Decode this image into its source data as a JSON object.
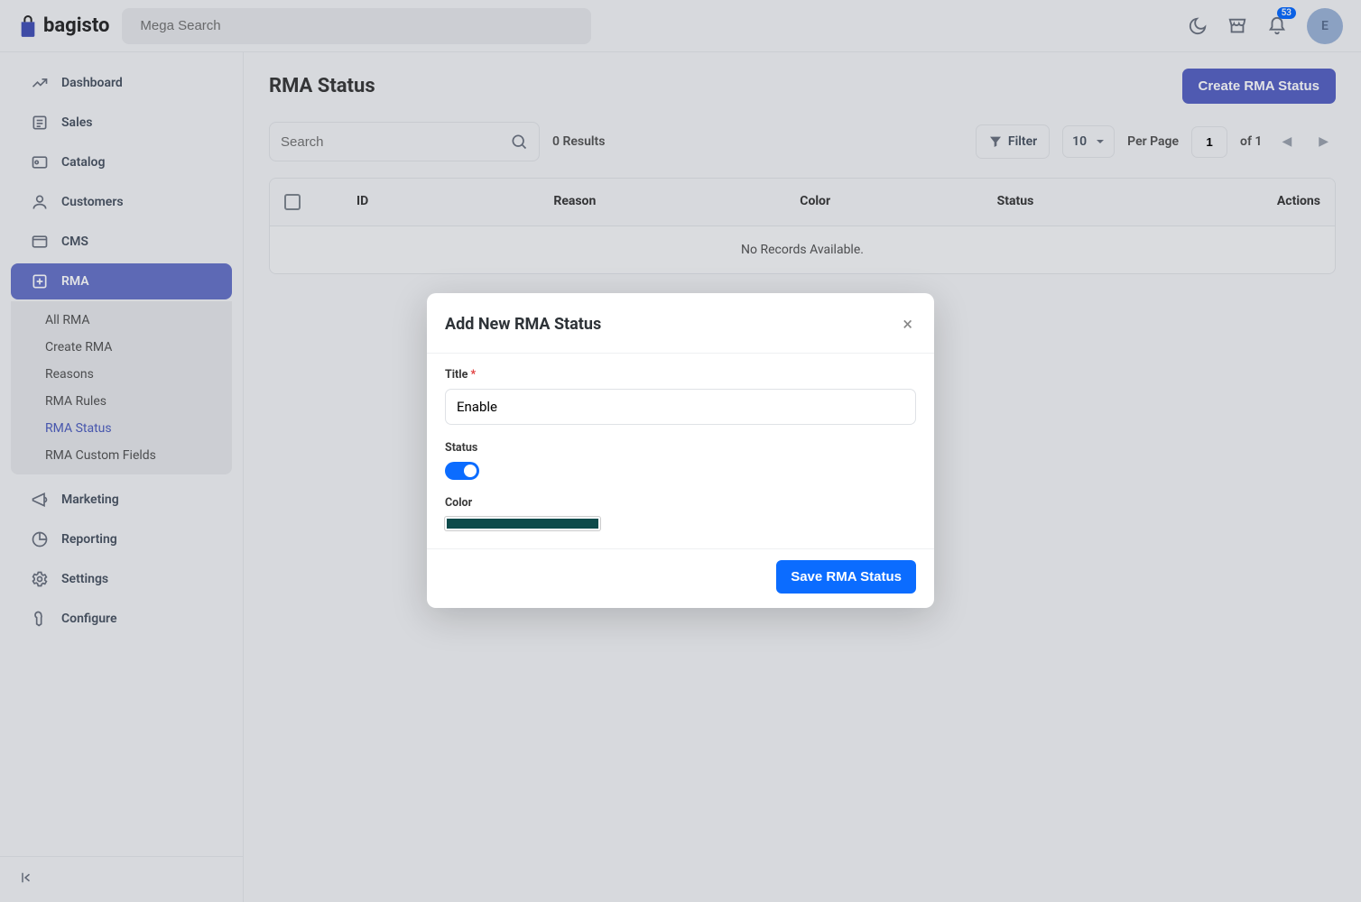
{
  "brand": "bagisto",
  "search_placeholder": "Mega Search",
  "notification_count": "53",
  "avatar_initial": "E",
  "sidebar": {
    "items": [
      {
        "label": "Dashboard",
        "icon": "dashboard"
      },
      {
        "label": "Sales",
        "icon": "sales"
      },
      {
        "label": "Catalog",
        "icon": "catalog"
      },
      {
        "label": "Customers",
        "icon": "customers"
      },
      {
        "label": "CMS",
        "icon": "cms"
      },
      {
        "label": "RMA",
        "icon": "rma",
        "active": true
      },
      {
        "label": "Marketing",
        "icon": "marketing"
      },
      {
        "label": "Reporting",
        "icon": "reporting"
      },
      {
        "label": "Settings",
        "icon": "settings"
      },
      {
        "label": "Configure",
        "icon": "configure"
      }
    ],
    "rma_sub": [
      {
        "label": "All RMA"
      },
      {
        "label": "Create RMA"
      },
      {
        "label": "Reasons"
      },
      {
        "label": "RMA Rules"
      },
      {
        "label": "RMA Status",
        "active": true
      },
      {
        "label": "RMA Custom Fields"
      }
    ]
  },
  "page": {
    "title": "RMA Status",
    "create_btn": "Create RMA Status",
    "toolbar": {
      "search_placeholder": "Search",
      "results": "0 Results",
      "filter": "Filter",
      "perpage_value": "10",
      "perpage_label": "Per Page",
      "page_value": "1",
      "of_label": "of 1"
    },
    "columns": {
      "id": "ID",
      "reason": "Reason",
      "color": "Color",
      "status": "Status",
      "actions": "Actions"
    },
    "empty": "No Records Available."
  },
  "modal": {
    "title": "Add New RMA Status",
    "title_label": "Title",
    "title_value": "Enable",
    "status_label": "Status",
    "status_on": true,
    "color_label": "Color",
    "color_value": "#0d4b4b",
    "save_btn": "Save RMA Status"
  }
}
